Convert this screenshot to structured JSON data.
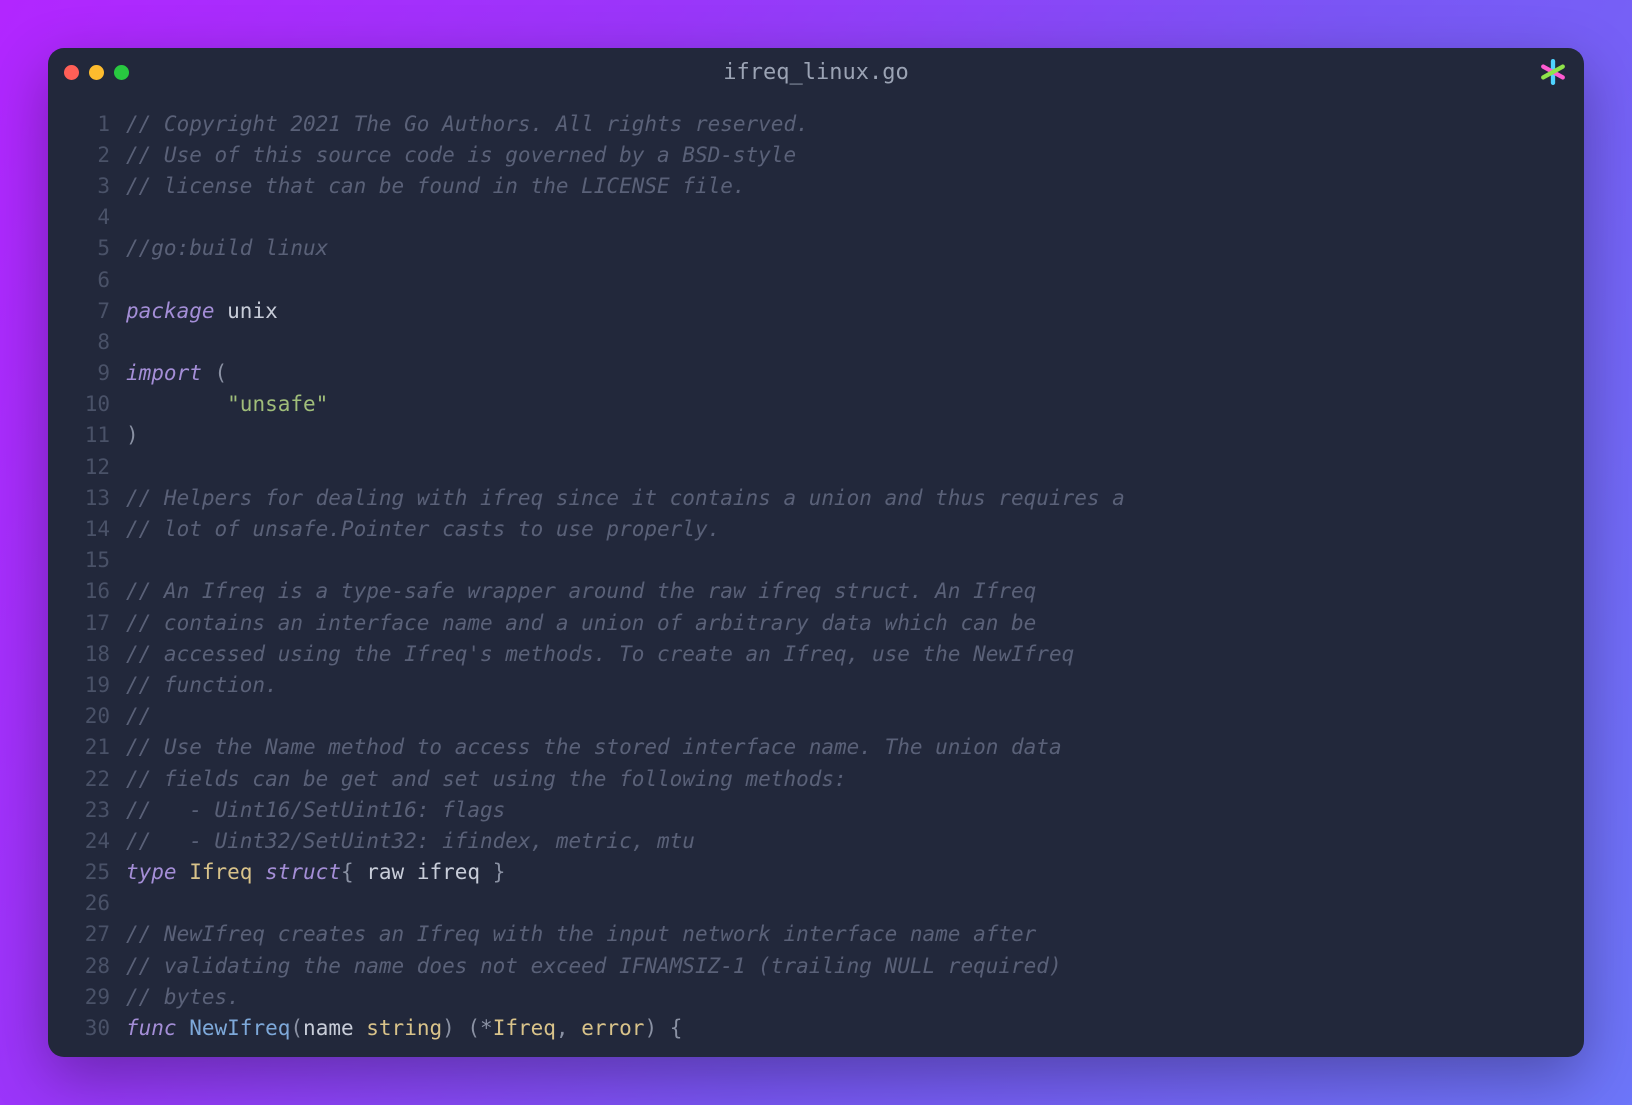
{
  "window": {
    "title": "ifreq_linux.go"
  },
  "code": {
    "lines": [
      {
        "n": 1,
        "segs": [
          {
            "c": "cmt",
            "t": "// Copyright 2021 The Go Authors. All rights reserved."
          }
        ]
      },
      {
        "n": 2,
        "segs": [
          {
            "c": "cmt",
            "t": "// Use of this source code is governed by a BSD-style"
          }
        ]
      },
      {
        "n": 3,
        "segs": [
          {
            "c": "cmt",
            "t": "// license that can be found in the LICENSE file."
          }
        ]
      },
      {
        "n": 4,
        "segs": []
      },
      {
        "n": 5,
        "segs": [
          {
            "c": "cmt",
            "t": "//go:build linux"
          }
        ]
      },
      {
        "n": 6,
        "segs": []
      },
      {
        "n": 7,
        "segs": [
          {
            "c": "kw",
            "t": "package"
          },
          {
            "c": "pkg",
            "t": " unix"
          }
        ]
      },
      {
        "n": 8,
        "segs": []
      },
      {
        "n": 9,
        "segs": [
          {
            "c": "kw",
            "t": "import"
          },
          {
            "c": "punct",
            "t": " ("
          }
        ]
      },
      {
        "n": 10,
        "segs": [
          {
            "c": "",
            "t": "        "
          },
          {
            "c": "str",
            "t": "\"unsafe\""
          }
        ]
      },
      {
        "n": 11,
        "segs": [
          {
            "c": "punct",
            "t": ")"
          }
        ]
      },
      {
        "n": 12,
        "segs": []
      },
      {
        "n": 13,
        "segs": [
          {
            "c": "cmt",
            "t": "// Helpers for dealing with ifreq since it contains a union and thus requires a"
          }
        ]
      },
      {
        "n": 14,
        "segs": [
          {
            "c": "cmt",
            "t": "// lot of unsafe.Pointer casts to use properly."
          }
        ]
      },
      {
        "n": 15,
        "segs": []
      },
      {
        "n": 16,
        "segs": [
          {
            "c": "cmt",
            "t": "// An Ifreq is a type-safe wrapper around the raw ifreq struct. An Ifreq"
          }
        ]
      },
      {
        "n": 17,
        "segs": [
          {
            "c": "cmt",
            "t": "// contains an interface name and a union of arbitrary data which can be"
          }
        ]
      },
      {
        "n": 18,
        "segs": [
          {
            "c": "cmt",
            "t": "// accessed using the Ifreq's methods. To create an Ifreq, use the NewIfreq"
          }
        ]
      },
      {
        "n": 19,
        "segs": [
          {
            "c": "cmt",
            "t": "// function."
          }
        ]
      },
      {
        "n": 20,
        "segs": [
          {
            "c": "cmt",
            "t": "//"
          }
        ]
      },
      {
        "n": 21,
        "segs": [
          {
            "c": "cmt",
            "t": "// Use the Name method to access the stored interface name. The union data"
          }
        ]
      },
      {
        "n": 22,
        "segs": [
          {
            "c": "cmt",
            "t": "// fields can be get and set using the following methods:"
          }
        ]
      },
      {
        "n": 23,
        "segs": [
          {
            "c": "cmt",
            "t": "//   - Uint16/SetUint16: flags"
          }
        ]
      },
      {
        "n": 24,
        "segs": [
          {
            "c": "cmt",
            "t": "//   - Uint32/SetUint32: ifindex, metric, mtu"
          }
        ]
      },
      {
        "n": 25,
        "segs": [
          {
            "c": "kw",
            "t": "type"
          },
          {
            "c": "",
            "t": " "
          },
          {
            "c": "type",
            "t": "Ifreq"
          },
          {
            "c": "",
            "t": " "
          },
          {
            "c": "kw",
            "t": "struct"
          },
          {
            "c": "punct",
            "t": "{ "
          },
          {
            "c": "",
            "t": "raw ifreq"
          },
          {
            "c": "punct",
            "t": " }"
          }
        ]
      },
      {
        "n": 26,
        "segs": []
      },
      {
        "n": 27,
        "segs": [
          {
            "c": "cmt",
            "t": "// NewIfreq creates an Ifreq with the input network interface name after"
          }
        ]
      },
      {
        "n": 28,
        "segs": [
          {
            "c": "cmt",
            "t": "// validating the name does not exceed IFNAMSIZ-1 (trailing NULL required)"
          }
        ]
      },
      {
        "n": 29,
        "segs": [
          {
            "c": "cmt",
            "t": "// bytes."
          }
        ]
      },
      {
        "n": 30,
        "segs": [
          {
            "c": "kw",
            "t": "func"
          },
          {
            "c": "",
            "t": " "
          },
          {
            "c": "fn",
            "t": "NewIfreq"
          },
          {
            "c": "punct",
            "t": "("
          },
          {
            "c": "",
            "t": "name "
          },
          {
            "c": "type",
            "t": "string"
          },
          {
            "c": "punct",
            "t": ") (*"
          },
          {
            "c": "type",
            "t": "Ifreq"
          },
          {
            "c": "punct",
            "t": ", "
          },
          {
            "c": "type",
            "t": "error"
          },
          {
            "c": "punct",
            "t": ") {"
          }
        ]
      }
    ]
  }
}
